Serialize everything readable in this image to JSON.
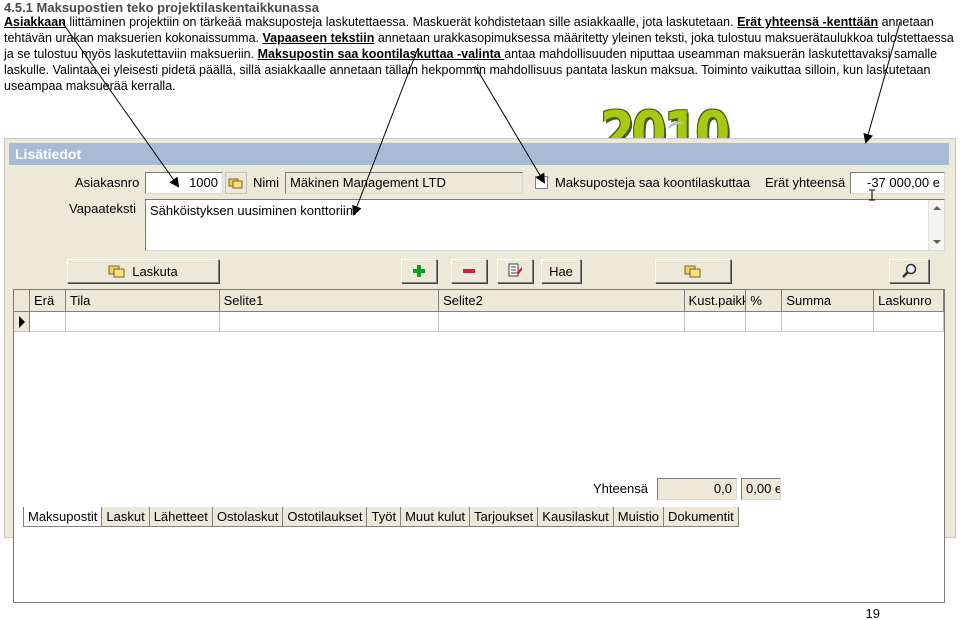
{
  "doc": {
    "heading": "4.5.1 Maksupostien teko projektilaskentaikkunassa",
    "para": [
      {
        "t": "b",
        "v": "Asiakkaan"
      },
      {
        "t": "n",
        "v": " liittäminen projektiin on tärkeää maksuposteja laskutettaessa. Maskuerät kohdistetaan sille asiakkaalle, jota laskutetaan. "
      },
      {
        "t": "b",
        "v": "Erät yhteensä -kenttään"
      },
      {
        "t": "n",
        "v": " annetaan tehtävän urakan maksuerien kokonaissumma. "
      },
      {
        "t": "b",
        "v": "Vapaaseen tekstiin"
      },
      {
        "t": "n",
        "v": " annetaan urakkasopimuksessa määritetty yleinen teksti, joka tulostuu maksuerätaulukkoa tulostettaessa ja se tulostuu myös laskutettaviin maksueriin. "
      },
      {
        "t": "b",
        "v": "Maksupostin saa koontilaskuttaa -valinta "
      },
      {
        "t": "n",
        "v": "antaa mahdollisuuden niputtaa useamman maksuerän laskutettavaksi samalle laskulle. Valintaa ei yleisesti pidetä päällä, sillä asiakkaalle annetaan tällain hekpommin mahdollisuus pantata laskun maksua. Toiminto vaikuttaa silloin, kun laskutetaan useampaa maksuerää kerralla."
      }
    ]
  },
  "logo": {
    "year": "2010"
  },
  "form": {
    "title": "Lisätiedot",
    "customer_no_label": "Asiakasnro",
    "customer_no_value": "1000",
    "name_label": "Nimi",
    "name_value": "Mäkinen Management LTD",
    "consolidate_label": "Maksuposteja saa koontilaskuttaa",
    "consolidate_checked": false,
    "total_label": "Erät yhteensä",
    "total_value": "-37 000,00 e",
    "free_text_label": "Vapaateksti",
    "free_text_value": "Sähköistyksen uusiminen konttoriin.",
    "laskuta_button": "Laskuta",
    "fetch_button": "Hae",
    "sum_label": "Yhteensä",
    "sum_value1": "0,0",
    "sum_value2": "0,00 e"
  },
  "grid": {
    "columns": [
      "Erä",
      "Tila",
      "Selite1",
      "Selite2",
      "Kust.paikka",
      "%",
      "Summa",
      "Laskunro"
    ]
  },
  "tabs": [
    "Maksupostit",
    "Laskut",
    "Lähetteet",
    "Ostolaskut",
    "Ostotilaukset",
    "Työt",
    "Muut kulut",
    "Tarjoukset",
    "Kausilaskut",
    "Muistio",
    "Dokumentit"
  ],
  "page_number": "19",
  "colors": {
    "title_bar": "#a7bcd4",
    "window_bg": "#ece9d8",
    "logo_green": "#a8c812"
  }
}
